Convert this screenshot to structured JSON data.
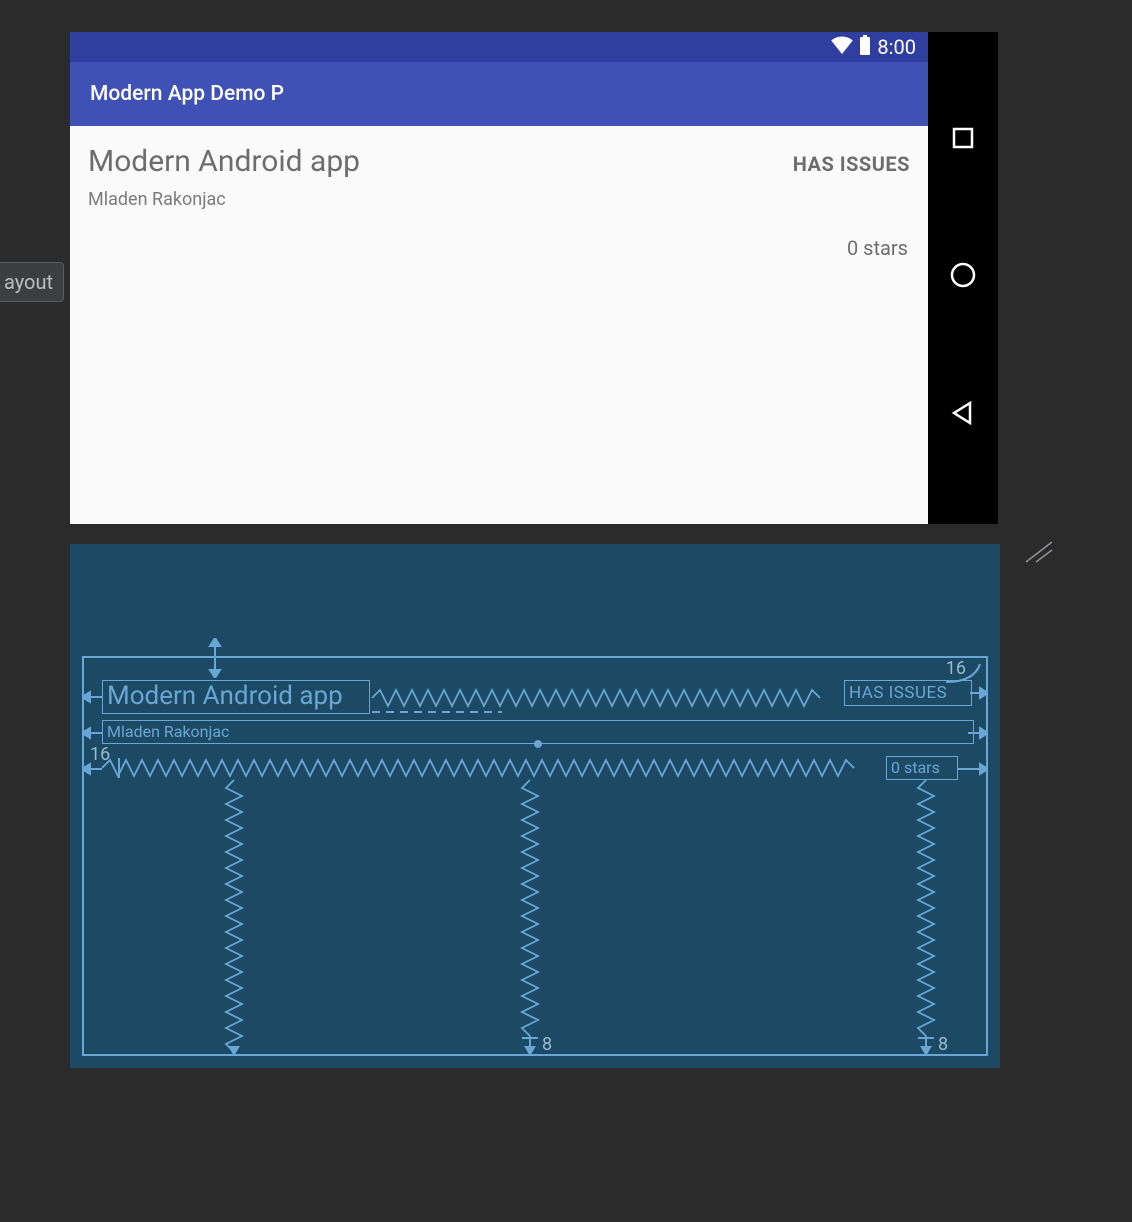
{
  "side_tab": {
    "label": "ayout"
  },
  "status": {
    "time": "8:00"
  },
  "app": {
    "title": "Modern App Demo P",
    "heading": "Modern Android app",
    "issues_badge": "HAS ISSUES",
    "author": "Mladen Rakonjac",
    "stars": "0 stars"
  },
  "blueprint": {
    "title": "Modern Android app",
    "issues_badge": "HAS ISSUES",
    "author": "Mladen Rakonjac",
    "stars": "0 stars",
    "margins": {
      "top_right": "16",
      "left_author": "16",
      "bottom_center": "8",
      "bottom_right": "8"
    }
  }
}
